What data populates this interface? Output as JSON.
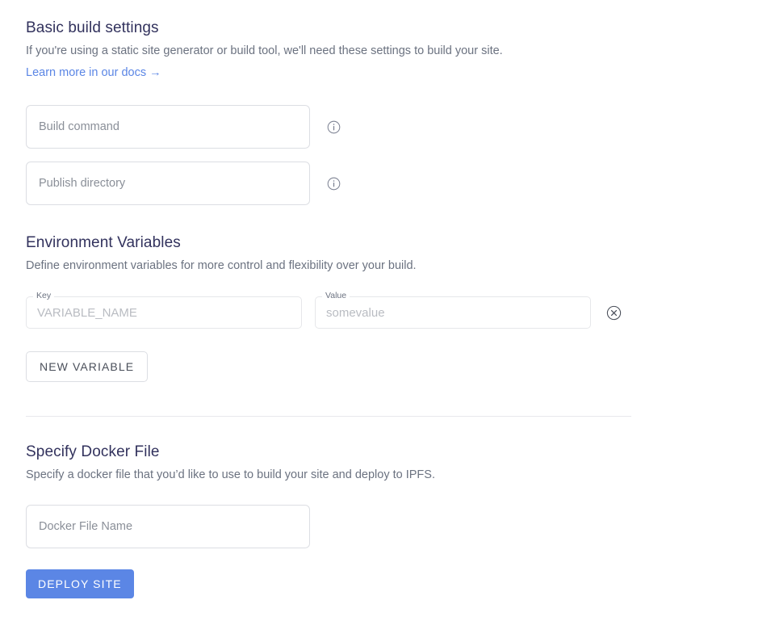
{
  "basic_build": {
    "title": "Basic build settings",
    "description": "If you're using a static site generator or build tool, we'll need these settings to build your site.",
    "docs_link": "Learn more in our docs",
    "docs_link_arrow": "→",
    "build_command_placeholder": "Build command",
    "build_command_value": "",
    "publish_directory_placeholder": "Publish directory",
    "publish_directory_value": "",
    "info_icon": "info-circle-icon"
  },
  "environment_variables": {
    "title": "Environment Variables",
    "description": "Define environment variables for more control and flexibility over your build.",
    "rows": [
      {
        "key_label": "Key",
        "key_placeholder": "VARIABLE_NAME",
        "key_value": "",
        "value_label": "Value",
        "value_placeholder": "somevalue",
        "value_value": "",
        "delete_icon": "circle-x-icon"
      }
    ],
    "new_variable_button": "NEW VARIABLE"
  },
  "docker": {
    "title": "Specify Docker File",
    "description": "Specify a docker file that you’d like to use to build your site and deploy to IPFS.",
    "file_name_placeholder": "Docker File Name",
    "file_name_value": ""
  },
  "deploy": {
    "button_label": "DEPLOY SITE"
  },
  "colors": {
    "accent": "#5b86e5",
    "text_primary": "#32325d",
    "text_secondary": "#6b7280",
    "placeholder": "#8a8f98",
    "border": "#dcdee3",
    "divider": "#e8e8ec"
  }
}
